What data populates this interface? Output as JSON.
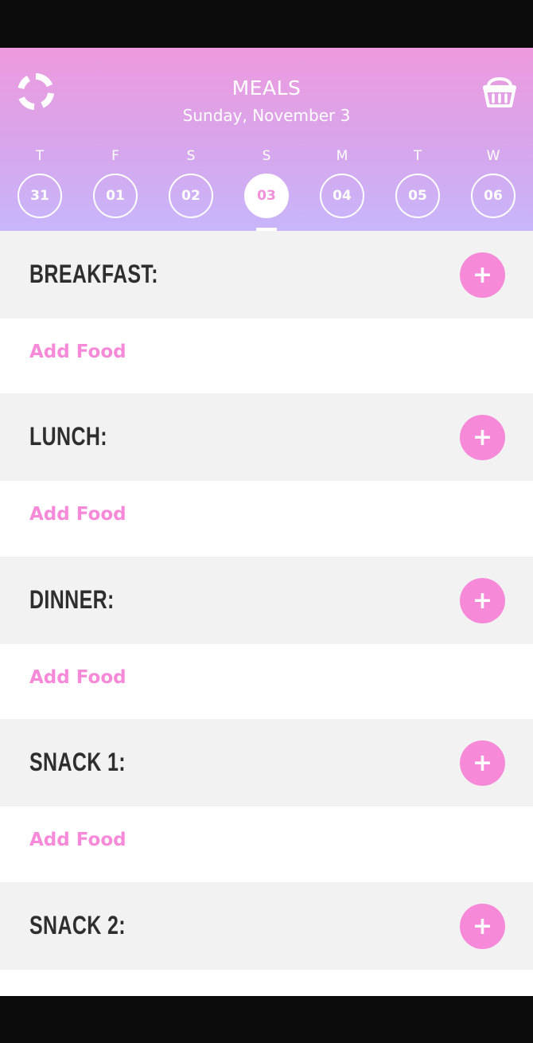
{
  "header": {
    "title": "MEALS",
    "date": "Sunday, November 3",
    "sync_icon": "sync-icon",
    "basket_icon": "basket-icon"
  },
  "week": {
    "days": [
      {
        "letter": "T",
        "number": "31",
        "active": false
      },
      {
        "letter": "F",
        "number": "01",
        "active": false
      },
      {
        "letter": "S",
        "number": "02",
        "active": false
      },
      {
        "letter": "S",
        "number": "03",
        "active": true
      },
      {
        "letter": "M",
        "number": "04",
        "active": false
      },
      {
        "letter": "T",
        "number": "05",
        "active": false
      },
      {
        "letter": "W",
        "number": "06",
        "active": false
      }
    ]
  },
  "meals": [
    {
      "title": "BREAKFAST:",
      "add_label": "+",
      "food_link": "Add Food"
    },
    {
      "title": "LUNCH:",
      "add_label": "+",
      "food_link": "Add Food"
    },
    {
      "title": "DINNER:",
      "add_label": "+",
      "food_link": "Add Food"
    },
    {
      "title": "SNACK 1:",
      "add_label": "+",
      "food_link": "Add Food"
    },
    {
      "title": "SNACK 2:",
      "add_label": "+"
    }
  ],
  "colors": {
    "accent": "#f78ad8",
    "header_top": "#ee9ade",
    "header_bottom": "#c8b6fb",
    "section_bg": "#f2f2f2"
  }
}
